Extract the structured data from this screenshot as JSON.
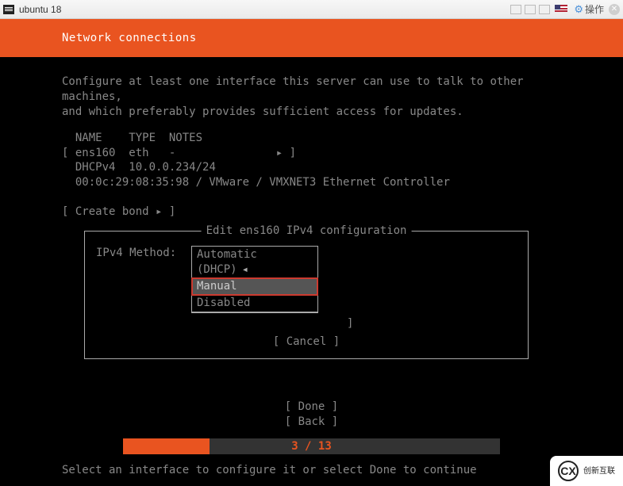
{
  "titlebar": {
    "title": "ubuntu 18",
    "action_label": "操作"
  },
  "header": {
    "title": "Network connections"
  },
  "desc_line1": "Configure at least one interface this server can use to talk to other machines,",
  "desc_line2": "and which preferably provides sufficient access for updates.",
  "iface_table": {
    "head_name": "NAME",
    "head_type": "TYPE",
    "head_notes": "NOTES",
    "row1_name": "ens160",
    "row1_type": "eth",
    "row1_notes": "-",
    "row1_arrow": "▸ ]",
    "row2_label": "DHCPv4",
    "row2_value": "10.0.0.234/24",
    "row3_mac": "00:0c:29:08:35:98 / VMware / VMXNET3 Ethernet Controller"
  },
  "create_bond": "[ Create bond ▸ ]",
  "dialog": {
    "title": "Edit ens160 IPv4 configuration",
    "label": "IPv4 Method:",
    "options": {
      "automatic": "Automatic (DHCP)",
      "manual": "Manual",
      "disabled": "Disabled"
    },
    "current_indicator": "◂",
    "dangling_bracket": "]",
    "cancel": "[ Cancel    ]"
  },
  "footer": {
    "done": "[ Done       ]",
    "back": "[ Back       ]"
  },
  "progress": {
    "current": 3,
    "total": 13,
    "text": "3 / 13",
    "fill_percent": 23
  },
  "hint": "Select an interface to configure it or select Done to continue",
  "watermark": {
    "brand": "创新互联"
  }
}
